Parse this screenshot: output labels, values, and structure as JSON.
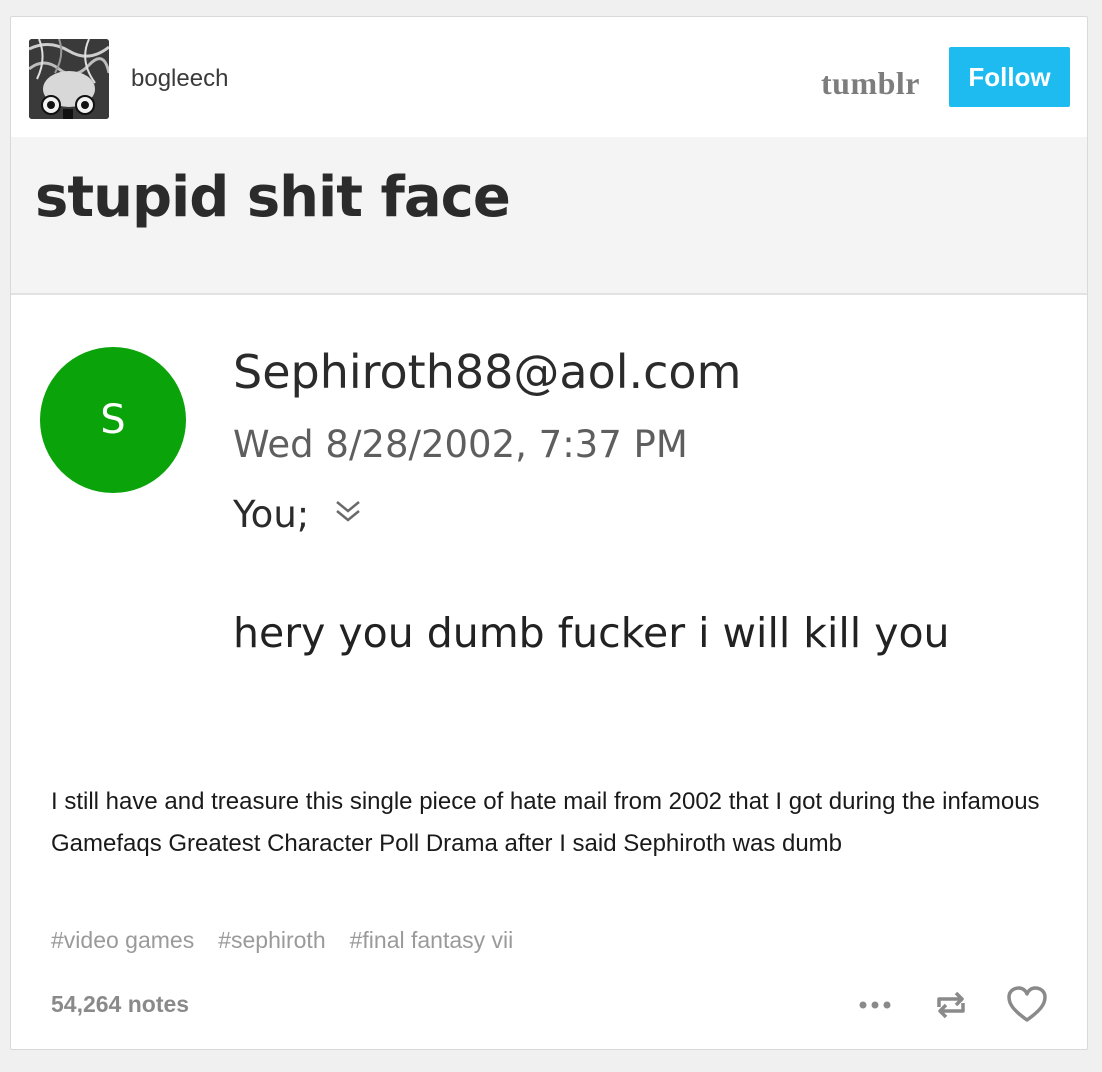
{
  "header": {
    "username": "bogleech",
    "logo_text": "tumblr",
    "follow_label": "Follow",
    "follow_color": "#1ebbf0"
  },
  "screenshot": {
    "subject": "stupid shit face",
    "sender_initial": "S",
    "sender_avatar_color": "#0aa30a",
    "sender_email": "Sephiroth88@aol.com",
    "sent_date": "Wed 8/28/2002, 7:37 PM",
    "recipient": "You;",
    "body": "hery you dumb fucker i will kill you"
  },
  "post": {
    "caption": "I still have and treasure this single piece of hate mail from 2002 that I got during the infamous Gamefaqs Greatest Character Poll Drama after I said Sephiroth was dumb",
    "tags": [
      "#video games",
      "#sephiroth",
      "#final fantasy vii"
    ],
    "notes": "54,264 notes"
  },
  "icons": {
    "more": "more-options-icon",
    "reblog": "reblog-icon",
    "like": "heart-icon",
    "expand": "chevron-double-down-icon"
  }
}
